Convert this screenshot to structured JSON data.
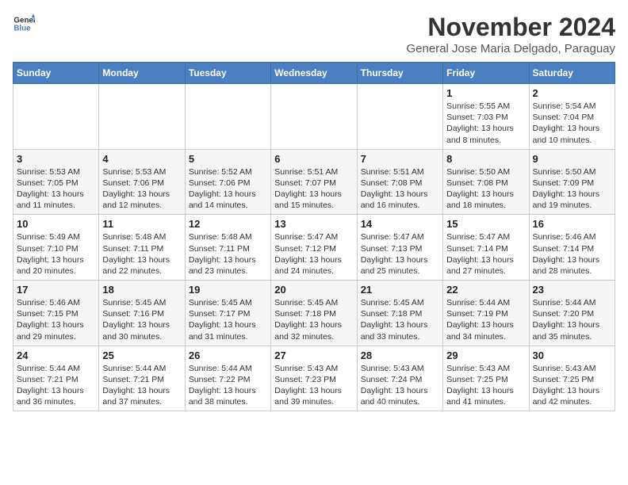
{
  "logo": {
    "general": "General",
    "blue": "Blue"
  },
  "title": "November 2024",
  "location": "General Jose Maria Delgado, Paraguay",
  "weekdays": [
    "Sunday",
    "Monday",
    "Tuesday",
    "Wednesday",
    "Thursday",
    "Friday",
    "Saturday"
  ],
  "weeks": [
    [
      {
        "day": "",
        "info": ""
      },
      {
        "day": "",
        "info": ""
      },
      {
        "day": "",
        "info": ""
      },
      {
        "day": "",
        "info": ""
      },
      {
        "day": "",
        "info": ""
      },
      {
        "day": "1",
        "info": "Sunrise: 5:55 AM\nSunset: 7:03 PM\nDaylight: 13 hours and 8 minutes."
      },
      {
        "day": "2",
        "info": "Sunrise: 5:54 AM\nSunset: 7:04 PM\nDaylight: 13 hours and 10 minutes."
      }
    ],
    [
      {
        "day": "3",
        "info": "Sunrise: 5:53 AM\nSunset: 7:05 PM\nDaylight: 13 hours and 11 minutes."
      },
      {
        "day": "4",
        "info": "Sunrise: 5:53 AM\nSunset: 7:06 PM\nDaylight: 13 hours and 12 minutes."
      },
      {
        "day": "5",
        "info": "Sunrise: 5:52 AM\nSunset: 7:06 PM\nDaylight: 13 hours and 14 minutes."
      },
      {
        "day": "6",
        "info": "Sunrise: 5:51 AM\nSunset: 7:07 PM\nDaylight: 13 hours and 15 minutes."
      },
      {
        "day": "7",
        "info": "Sunrise: 5:51 AM\nSunset: 7:08 PM\nDaylight: 13 hours and 16 minutes."
      },
      {
        "day": "8",
        "info": "Sunrise: 5:50 AM\nSunset: 7:08 PM\nDaylight: 13 hours and 18 minutes."
      },
      {
        "day": "9",
        "info": "Sunrise: 5:50 AM\nSunset: 7:09 PM\nDaylight: 13 hours and 19 minutes."
      }
    ],
    [
      {
        "day": "10",
        "info": "Sunrise: 5:49 AM\nSunset: 7:10 PM\nDaylight: 13 hours and 20 minutes."
      },
      {
        "day": "11",
        "info": "Sunrise: 5:48 AM\nSunset: 7:11 PM\nDaylight: 13 hours and 22 minutes."
      },
      {
        "day": "12",
        "info": "Sunrise: 5:48 AM\nSunset: 7:11 PM\nDaylight: 13 hours and 23 minutes."
      },
      {
        "day": "13",
        "info": "Sunrise: 5:47 AM\nSunset: 7:12 PM\nDaylight: 13 hours and 24 minutes."
      },
      {
        "day": "14",
        "info": "Sunrise: 5:47 AM\nSunset: 7:13 PM\nDaylight: 13 hours and 25 minutes."
      },
      {
        "day": "15",
        "info": "Sunrise: 5:47 AM\nSunset: 7:14 PM\nDaylight: 13 hours and 27 minutes."
      },
      {
        "day": "16",
        "info": "Sunrise: 5:46 AM\nSunset: 7:14 PM\nDaylight: 13 hours and 28 minutes."
      }
    ],
    [
      {
        "day": "17",
        "info": "Sunrise: 5:46 AM\nSunset: 7:15 PM\nDaylight: 13 hours and 29 minutes."
      },
      {
        "day": "18",
        "info": "Sunrise: 5:45 AM\nSunset: 7:16 PM\nDaylight: 13 hours and 30 minutes."
      },
      {
        "day": "19",
        "info": "Sunrise: 5:45 AM\nSunset: 7:17 PM\nDaylight: 13 hours and 31 minutes."
      },
      {
        "day": "20",
        "info": "Sunrise: 5:45 AM\nSunset: 7:18 PM\nDaylight: 13 hours and 32 minutes."
      },
      {
        "day": "21",
        "info": "Sunrise: 5:45 AM\nSunset: 7:18 PM\nDaylight: 13 hours and 33 minutes."
      },
      {
        "day": "22",
        "info": "Sunrise: 5:44 AM\nSunset: 7:19 PM\nDaylight: 13 hours and 34 minutes."
      },
      {
        "day": "23",
        "info": "Sunrise: 5:44 AM\nSunset: 7:20 PM\nDaylight: 13 hours and 35 minutes."
      }
    ],
    [
      {
        "day": "24",
        "info": "Sunrise: 5:44 AM\nSunset: 7:21 PM\nDaylight: 13 hours and 36 minutes."
      },
      {
        "day": "25",
        "info": "Sunrise: 5:44 AM\nSunset: 7:21 PM\nDaylight: 13 hours and 37 minutes."
      },
      {
        "day": "26",
        "info": "Sunrise: 5:44 AM\nSunset: 7:22 PM\nDaylight: 13 hours and 38 minutes."
      },
      {
        "day": "27",
        "info": "Sunrise: 5:43 AM\nSunset: 7:23 PM\nDaylight: 13 hours and 39 minutes."
      },
      {
        "day": "28",
        "info": "Sunrise: 5:43 AM\nSunset: 7:24 PM\nDaylight: 13 hours and 40 minutes."
      },
      {
        "day": "29",
        "info": "Sunrise: 5:43 AM\nSunset: 7:25 PM\nDaylight: 13 hours and 41 minutes."
      },
      {
        "day": "30",
        "info": "Sunrise: 5:43 AM\nSunset: 7:25 PM\nDaylight: 13 hours and 42 minutes."
      }
    ]
  ]
}
